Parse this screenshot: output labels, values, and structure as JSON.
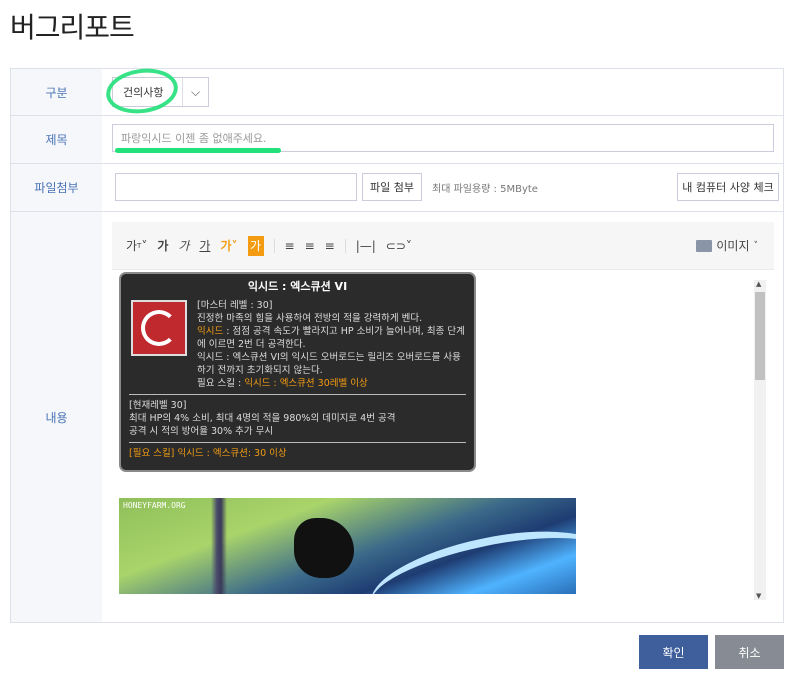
{
  "page": {
    "title": "버그리포트"
  },
  "form": {
    "category": {
      "label": "구분",
      "value": "건의사항"
    },
    "subject": {
      "label": "제목",
      "value": "파랑익시드 이젠 좀 없애주세요."
    },
    "attachment": {
      "label": "파일첨부",
      "attach_button": "파일 첨부",
      "max_size_note": "최대 파일용량 : 5MByte",
      "spec_check_button": "내 컴퓨터 사양 체크"
    },
    "content": {
      "label": "내용",
      "toolbar": {
        "font_size": "가",
        "bold": "가",
        "italic": "가",
        "underline": "가",
        "font_color": "가",
        "bg_color": "가",
        "image_label": "이미지"
      },
      "skill_tooltip": {
        "title": "익시드 : 엑스큐션 VI",
        "master_level": "[마스터 레벨 : 30]",
        "desc1": "진정한 마족의 힘을 사용하여 전방의 적을 강력하게 벤다.",
        "desc2_prefix": "익시드",
        "desc2_rest": " : 점점 공격 속도가 빨라지고 HP 소비가 늘어나며, 최종 단계에 이르면 2번 더 공격한다.",
        "desc3": "익시드 : 엑스큐션 VI의 익시드 오버로드는 릴리즈 오버로드를 사용하기 전까지 초기화되지 않는다.",
        "required_prefix": "필요 스킬 : ",
        "required_value": "익시드 : 엑스큐션 30레벨 이상",
        "current_level": "[현재레벨 30]",
        "current_desc1": "최대 HP의 4% 소비, 최대 4명의 적을 980%의 데미지로 4번 공격",
        "current_desc2": "공격 시 적의 방어율 30% 추가 무시",
        "footer_required": "[필요 스킬] 익시드 : 엑스큐션: 30 이상"
      },
      "game_image": {
        "watermark": "HONEYFARM.ORG"
      }
    }
  },
  "actions": {
    "confirm": "확인",
    "cancel": "취소"
  },
  "colors": {
    "accent": "#3f5e9c",
    "highlight": "#22e07a",
    "orange": "#f39c12"
  }
}
